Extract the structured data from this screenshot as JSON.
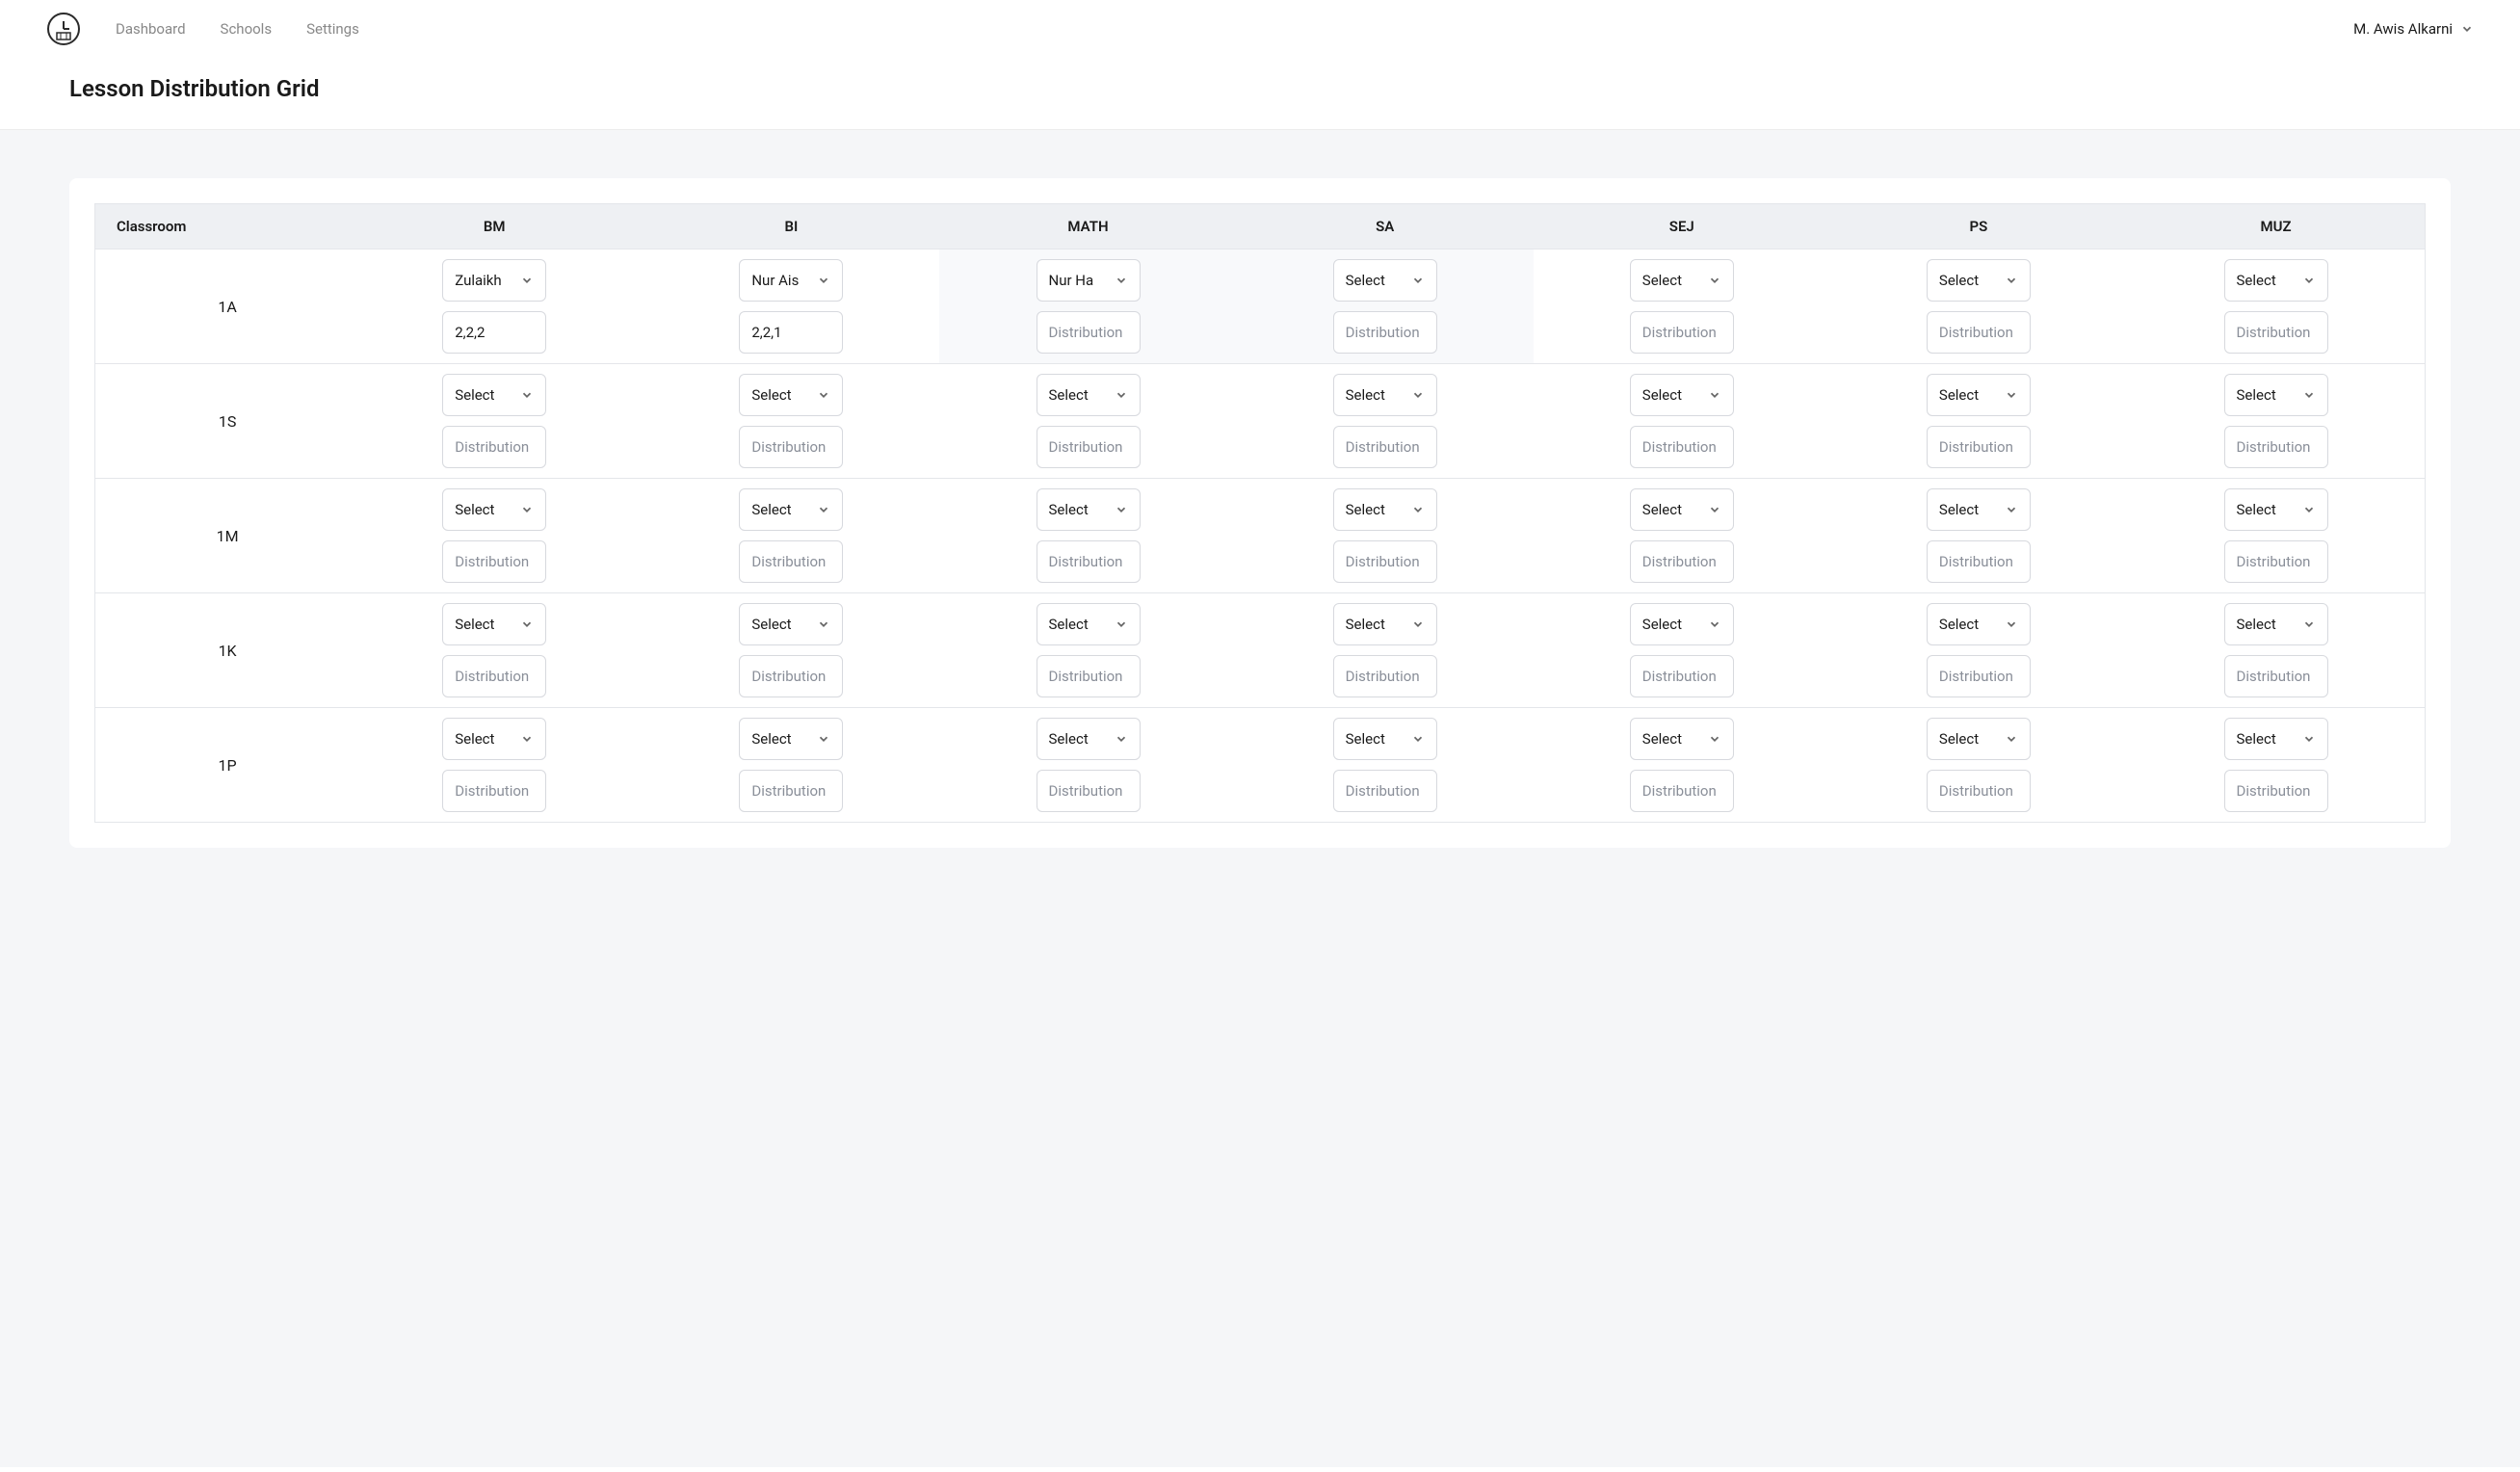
{
  "nav": {
    "links": [
      "Dashboard",
      "Schools",
      "Settings"
    ]
  },
  "user": {
    "name": "M. Awis Alkarni"
  },
  "page": {
    "title": "Lesson Distribution Grid"
  },
  "grid": {
    "firstHeader": "Classroom",
    "subjects": [
      "BM",
      "BI",
      "MATH",
      "SA",
      "SEJ",
      "PS",
      "MUZ"
    ],
    "selectPlaceholder": "Select",
    "distPlaceholder": "Distribution",
    "rows": [
      {
        "classroom": "1A",
        "cells": [
          {
            "teacher": "Zulaikh",
            "dist": "2,2,2"
          },
          {
            "teacher": "Nur Ais",
            "dist": "2,2,1"
          },
          {
            "teacher": "Nur Ha",
            "dist": "",
            "highlight": true
          },
          {
            "teacher": "",
            "dist": "",
            "highlight": true
          },
          {
            "teacher": "",
            "dist": ""
          },
          {
            "teacher": "",
            "dist": ""
          },
          {
            "teacher": "",
            "dist": ""
          }
        ]
      },
      {
        "classroom": "1S",
        "cells": [
          {
            "teacher": "",
            "dist": ""
          },
          {
            "teacher": "",
            "dist": ""
          },
          {
            "teacher": "",
            "dist": ""
          },
          {
            "teacher": "",
            "dist": ""
          },
          {
            "teacher": "",
            "dist": ""
          },
          {
            "teacher": "",
            "dist": ""
          },
          {
            "teacher": "",
            "dist": ""
          }
        ]
      },
      {
        "classroom": "1M",
        "cells": [
          {
            "teacher": "",
            "dist": ""
          },
          {
            "teacher": "",
            "dist": ""
          },
          {
            "teacher": "",
            "dist": ""
          },
          {
            "teacher": "",
            "dist": ""
          },
          {
            "teacher": "",
            "dist": ""
          },
          {
            "teacher": "",
            "dist": ""
          },
          {
            "teacher": "",
            "dist": ""
          }
        ]
      },
      {
        "classroom": "1K",
        "cells": [
          {
            "teacher": "",
            "dist": ""
          },
          {
            "teacher": "",
            "dist": ""
          },
          {
            "teacher": "",
            "dist": ""
          },
          {
            "teacher": "",
            "dist": ""
          },
          {
            "teacher": "",
            "dist": ""
          },
          {
            "teacher": "",
            "dist": ""
          },
          {
            "teacher": "",
            "dist": ""
          }
        ]
      },
      {
        "classroom": "1P",
        "cells": [
          {
            "teacher": "",
            "dist": ""
          },
          {
            "teacher": "",
            "dist": ""
          },
          {
            "teacher": "",
            "dist": ""
          },
          {
            "teacher": "",
            "dist": ""
          },
          {
            "teacher": "",
            "dist": ""
          },
          {
            "teacher": "",
            "dist": ""
          },
          {
            "teacher": "",
            "dist": ""
          }
        ]
      }
    ]
  }
}
